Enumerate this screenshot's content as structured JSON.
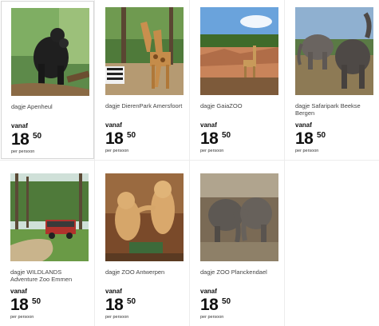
{
  "cards": [
    {
      "name": "dagje Apenheul",
      "from": "vanaf",
      "price_int": "18",
      "price_dec": "50",
      "per": "per persoon"
    },
    {
      "name": "dagje DierenPark Amersfoort",
      "from": "vanaf",
      "price_int": "18",
      "price_dec": "50",
      "per": "per persoon"
    },
    {
      "name": "dagje GaiaZOO",
      "from": "vanaf",
      "price_int": "18",
      "price_dec": "50",
      "per": "per persoon"
    },
    {
      "name": "dagje Safaripark Beekse Bergen",
      "from": "vanaf",
      "price_int": "18",
      "price_dec": "50",
      "per": "per persoon"
    },
    {
      "name": "dagje WILDLANDS Adventure Zoo Emmen",
      "from": "vanaf",
      "price_int": "18",
      "price_dec": "50",
      "per": "per persoon"
    },
    {
      "name": "dagje ZOO Antwerpen",
      "from": "vanaf",
      "price_int": "18",
      "price_dec": "50",
      "per": "per persoon"
    },
    {
      "name": "dagje ZOO Planckendael",
      "from": "vanaf",
      "price_int": "18",
      "price_dec": "50",
      "per": "per persoon"
    }
  ]
}
